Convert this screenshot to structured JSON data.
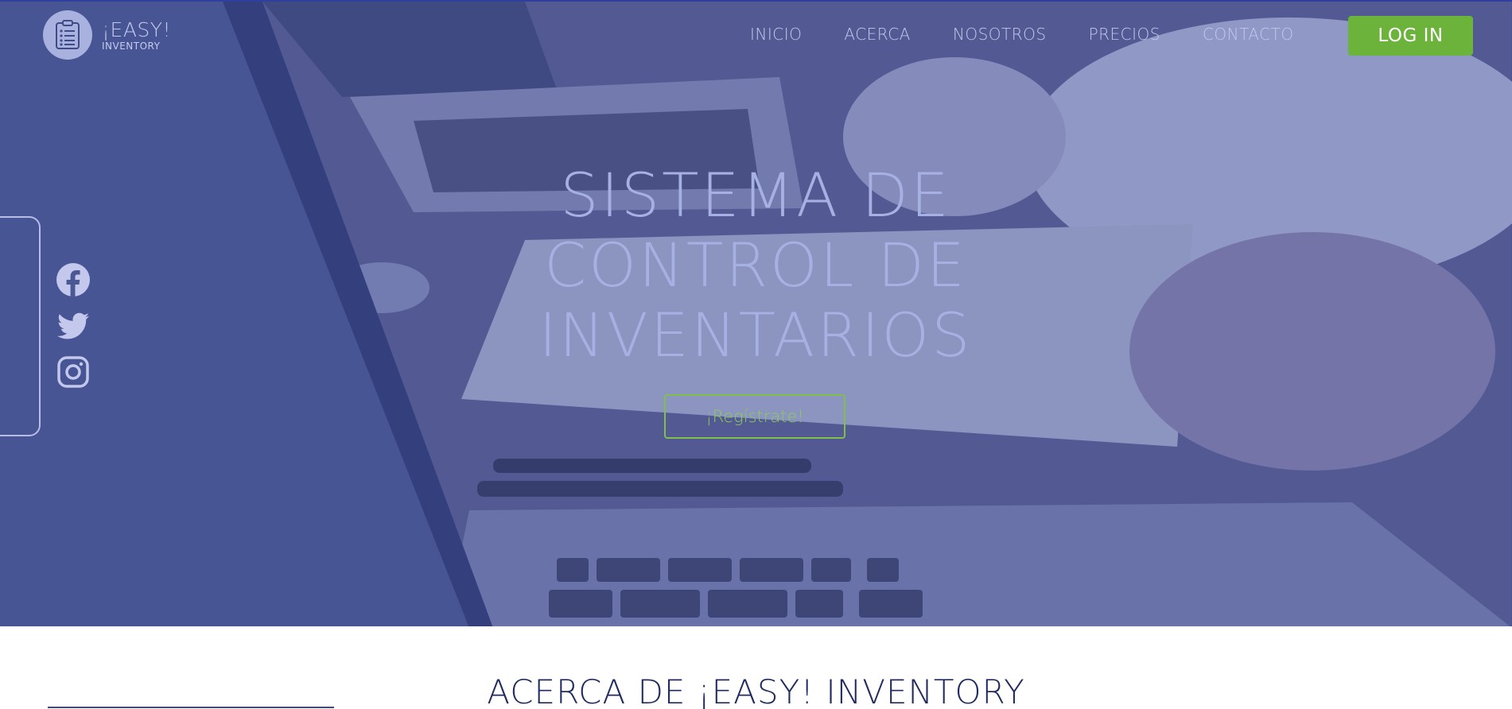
{
  "brand": {
    "title": "¡EASY!",
    "subtitle": "INVENTORY"
  },
  "nav": {
    "items": [
      "INICIO",
      "ACERCA",
      "NOSOTROS",
      "PRECIOS",
      "CONTACTO"
    ],
    "login_label": "LOG IN"
  },
  "social": {
    "icons": [
      "facebook-icon",
      "twitter-icon",
      "instagram-icon"
    ]
  },
  "hero": {
    "headline_lines": [
      "SISTEMA DE",
      "CONTROL DE",
      "INVENTARIOS"
    ],
    "cta_label": "¡Regístrate!"
  },
  "about": {
    "title": "ACERCA DE ¡EASY! INVENTORY"
  },
  "colors": {
    "overlay": "#4a5794",
    "accent_green": "#6cb33c",
    "nav_text": "#c2c8ec",
    "heading_dark": "#1f2a5e"
  }
}
